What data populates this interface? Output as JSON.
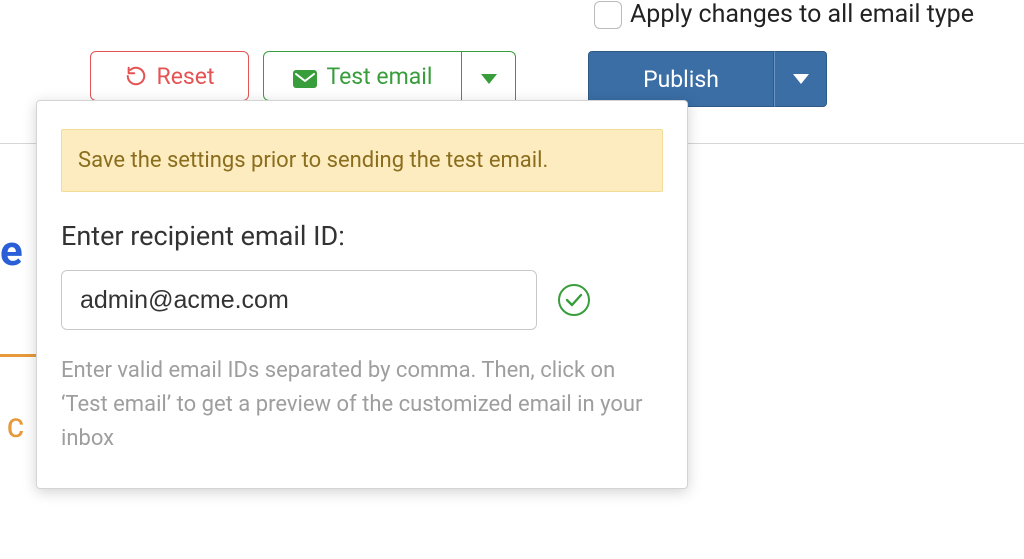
{
  "header": {
    "apply_all_label": "Apply changes to all email type"
  },
  "toolbar": {
    "reset_label": "Reset",
    "test_email_label": "Test email",
    "publish_label": "Publish"
  },
  "panel": {
    "alert_text": "Save the settings prior to sending the test email.",
    "field_label": "Enter recipient email ID:",
    "email_value": "admin@acme.com",
    "help_text": "Enter valid email IDs separated by comma. Then, click on ‘Test email’ to get a preview of the customized email in your inbox"
  },
  "background": {
    "blue_fragment": "e",
    "orange_fragment": "C"
  },
  "colors": {
    "danger": "#e55353",
    "success": "#389e3c",
    "primary": "#3a6ea5",
    "warning_bg": "#fdecc0",
    "warning_text": "#8a6d1d"
  }
}
